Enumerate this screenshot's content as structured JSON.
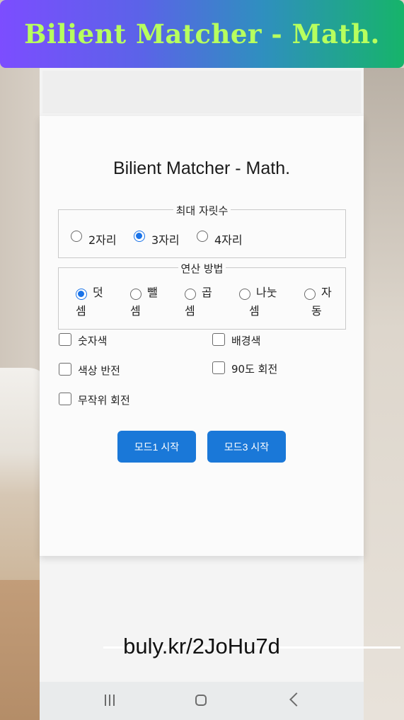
{
  "banner": {
    "title": "Bilient Matcher - Math."
  },
  "app": {
    "title": "Bilient Matcher - Math."
  },
  "digits": {
    "legend": "최대 자릿수",
    "options": [
      "2자리",
      "3자리",
      "4자리"
    ],
    "selected": "3자리"
  },
  "operation": {
    "legend": "연산 방법",
    "options": [
      {
        "line1": "덧",
        "line2": "셈"
      },
      {
        "line1": "뺄",
        "line2": "셈"
      },
      {
        "line1": "곱",
        "line2": "셈"
      },
      {
        "line1": "나눗",
        "line2": "셈"
      },
      {
        "line1": "자",
        "line2": "동"
      }
    ],
    "selected": "덧셈"
  },
  "options": {
    "number_color": "숫자색",
    "background_color": "배경색",
    "invert_color": "색상 반전",
    "rotate_90": "90도 회전",
    "random_rotate": "무작위 회전"
  },
  "buttons": {
    "mode1": "모드1 시작",
    "mode3": "모드3 시작"
  },
  "footer": {
    "url": "buly.kr/2JoHu7d"
  },
  "colors": {
    "accent": "#1a78d8",
    "banner_text": "#b7ff5e",
    "banner_start": "#7c4dff",
    "banner_end": "#16b46a"
  },
  "navbar": {
    "icons": [
      "recent-apps-icon",
      "home-icon",
      "back-icon"
    ]
  }
}
